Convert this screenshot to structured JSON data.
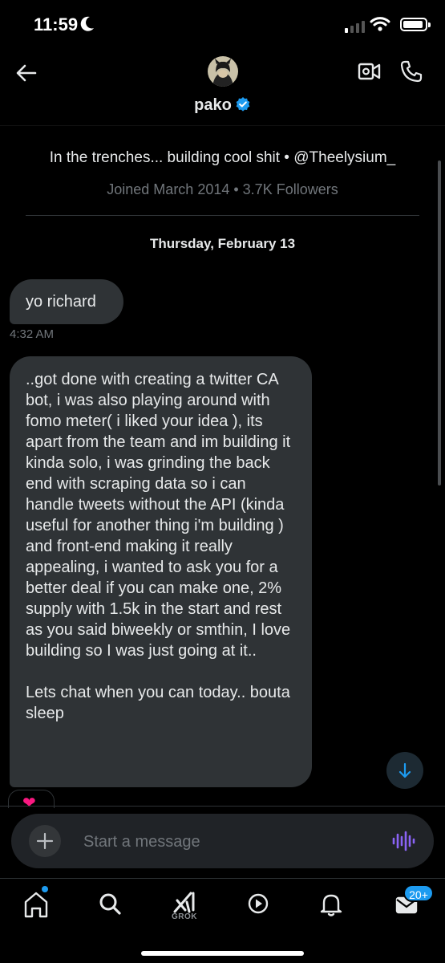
{
  "status_bar": {
    "time": "11:59"
  },
  "header": {
    "name": "pako"
  },
  "profile": {
    "bio": "In the trenches... building cool shit • @Theelysium_",
    "joined": "Joined March 2014 • 3.7K Followers"
  },
  "date_separator": "Thursday, February 13",
  "messages": [
    {
      "text": "yo richard",
      "time": "4:32 AM"
    },
    {
      "paragraphs": [
        "..got done with creating a twitter CA bot, i was also playing around with fomo meter( i liked your idea ), its apart from the team and im building it kinda solo, i was grinding the back end with scraping data so i can handle tweets without the API (kinda useful for another thing i'm building ) and front-end making it really appealing, i wanted to ask you for a better deal if you can make one,  2% supply with 1.5k in the start and rest as you said biweekly or smthin, I love building so I was just going at it..",
        "Lets chat when you can today.. bouta sleep"
      ],
      "reaction": "❤"
    }
  ],
  "composer": {
    "placeholder": "Start a message"
  },
  "bottom_nav": {
    "items": [
      "home-icon",
      "search-icon",
      "grok-icon",
      "video-icon",
      "notifications-icon",
      "messages-icon"
    ],
    "grok_label": "GROK",
    "messages_badge": "20+"
  },
  "colors": {
    "accent": "#1d9bf0",
    "bubble": "#2f3336",
    "muted_text": "#71767b",
    "heart": "#f91880",
    "voice": "#8a63f6"
  }
}
